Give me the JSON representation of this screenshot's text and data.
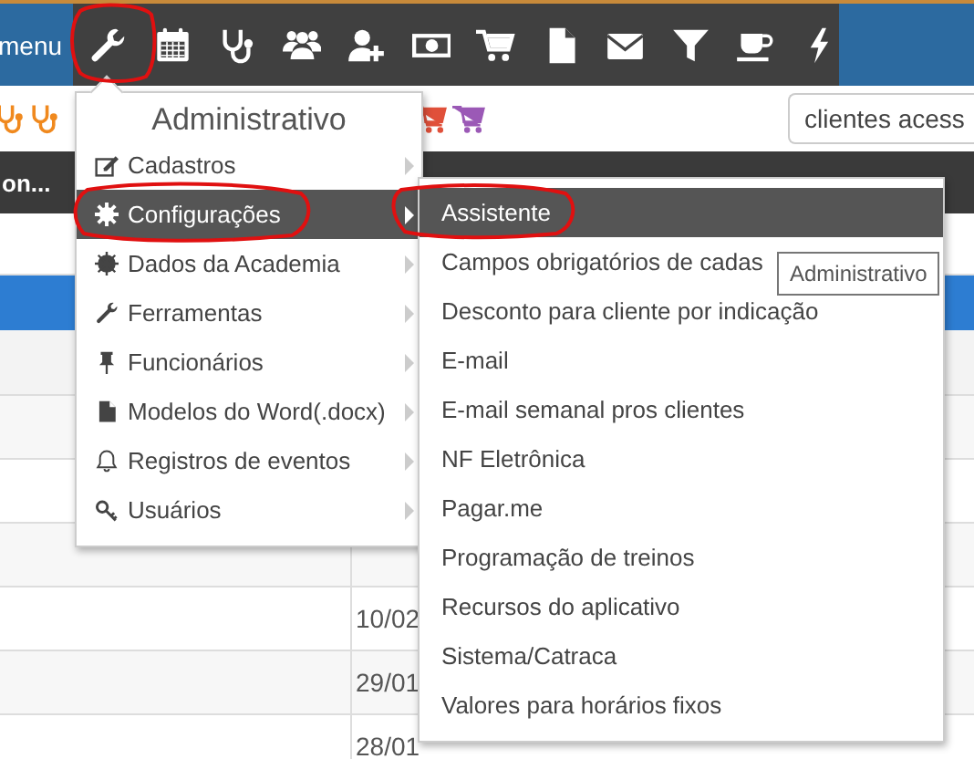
{
  "top_bar": {
    "menu_label": "menu"
  },
  "tool_row": {
    "search": {
      "value": "clientes acess"
    }
  },
  "section_bar": {
    "label": "on..."
  },
  "table": {
    "dates": [
      "10/02",
      "29/01",
      "28/01"
    ]
  },
  "menu": {
    "title": "Administrativo",
    "items": [
      {
        "label": "Cadastros",
        "selected": false
      },
      {
        "label": "Configurações",
        "selected": true
      },
      {
        "label": "Dados da Academia",
        "selected": false
      },
      {
        "label": "Ferramentas",
        "selected": false
      },
      {
        "label": "Funcionários",
        "selected": false
      },
      {
        "label": "Modelos do Word(.docx)",
        "selected": false
      },
      {
        "label": "Registros de eventos",
        "selected": false
      },
      {
        "label": "Usuários",
        "selected": false
      }
    ]
  },
  "submenu": {
    "items": [
      {
        "label": "Assistente",
        "selected": true
      },
      {
        "label": "Campos obrigatórios de cadas",
        "selected": false
      },
      {
        "label": "Desconto para cliente por indicação",
        "selected": false
      },
      {
        "label": "E-mail",
        "selected": false
      },
      {
        "label": "E-mail semanal pros clientes",
        "selected": false
      },
      {
        "label": "NF Eletrônica",
        "selected": false
      },
      {
        "label": "Pagar.me",
        "selected": false
      },
      {
        "label": "Programação de treinos",
        "selected": false
      },
      {
        "label": "Recursos do aplicativo",
        "selected": false
      },
      {
        "label": "Sistema/Catraca",
        "selected": false
      },
      {
        "label": "Valores para horários fixos",
        "selected": false
      }
    ],
    "tooltip": "Administrativo"
  }
}
